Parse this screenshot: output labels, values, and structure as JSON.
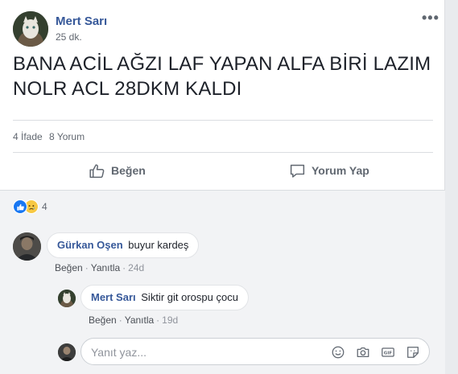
{
  "post": {
    "author": "Mert Sarı",
    "time": "25 dk.",
    "more_label": "•••",
    "text": "BANA ACİL AĞZI LAF YAPAN ALFA BİRİ LAZIM NOLR ACL 28DKM KALDI",
    "reactions_count": "4 İfade",
    "comments_count": "8 Yorum"
  },
  "actions": {
    "like_label": "Beğen",
    "comment_label": "Yorum Yap"
  },
  "reactions": {
    "count": "4"
  },
  "comments": [
    {
      "author": "Gürkan Oşen",
      "text": "buyur kardeş",
      "like_label": "Beğen",
      "reply_label": "Yanıtla",
      "age": "24d"
    },
    {
      "author": "Mert Sarı",
      "text": "Siktir git orospu çocu",
      "like_label": "Beğen",
      "reply_label": "Yanıtla",
      "age": "19d"
    }
  ],
  "composer": {
    "placeholder": "Yanıt yaz..."
  },
  "colors": {
    "link": "#365899",
    "like_blue": "#1877f2",
    "sad_yellow": "#f7c843",
    "comments_bg": "#f2f3f5"
  },
  "icons": [
    "thumbs-up-icon",
    "comment-icon",
    "like-reaction-icon",
    "sad-reaction-icon",
    "emoji-icon",
    "camera-icon",
    "gif-icon",
    "sticker-icon"
  ]
}
